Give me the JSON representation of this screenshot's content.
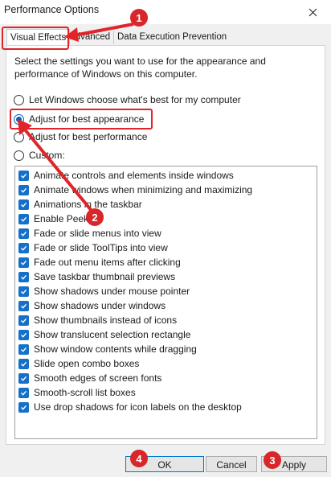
{
  "window": {
    "title": "Performance Options"
  },
  "tabs": [
    {
      "label": "Visual Effects"
    },
    {
      "label": "Advanced"
    },
    {
      "label": "Data Execution Prevention"
    }
  ],
  "description": "Select the settings you want to use for the appearance and performance of Windows on this computer.",
  "radios": [
    {
      "label": "Let Windows choose what's best for my computer",
      "checked": false
    },
    {
      "label": "Adjust for best appearance",
      "checked": true
    },
    {
      "label": "Adjust for best performance",
      "checked": false
    },
    {
      "label": "Custom:",
      "checked": false
    }
  ],
  "options": [
    "Animate controls and elements inside windows",
    "Animate windows when minimizing and maximizing",
    "Animations in the taskbar",
    "Enable Peek",
    "Fade or slide menus into view",
    "Fade or slide ToolTips into view",
    "Fade out menu items after clicking",
    "Save taskbar thumbnail previews",
    "Show shadows under mouse pointer",
    "Show shadows under windows",
    "Show thumbnails instead of icons",
    "Show translucent selection rectangle",
    "Show window contents while dragging",
    "Slide open combo boxes",
    "Smooth edges of screen fonts",
    "Smooth-scroll list boxes",
    "Use drop shadows for icon labels on the desktop"
  ],
  "buttons": {
    "ok": "OK",
    "cancel": "Cancel",
    "apply": "Apply"
  },
  "annotations": {
    "step1": "1",
    "step2": "2",
    "step3": "3",
    "step4": "4"
  },
  "colors": {
    "accent": "#0060c0",
    "checkbox": "#1570c9",
    "annotation": "#d8262a"
  }
}
